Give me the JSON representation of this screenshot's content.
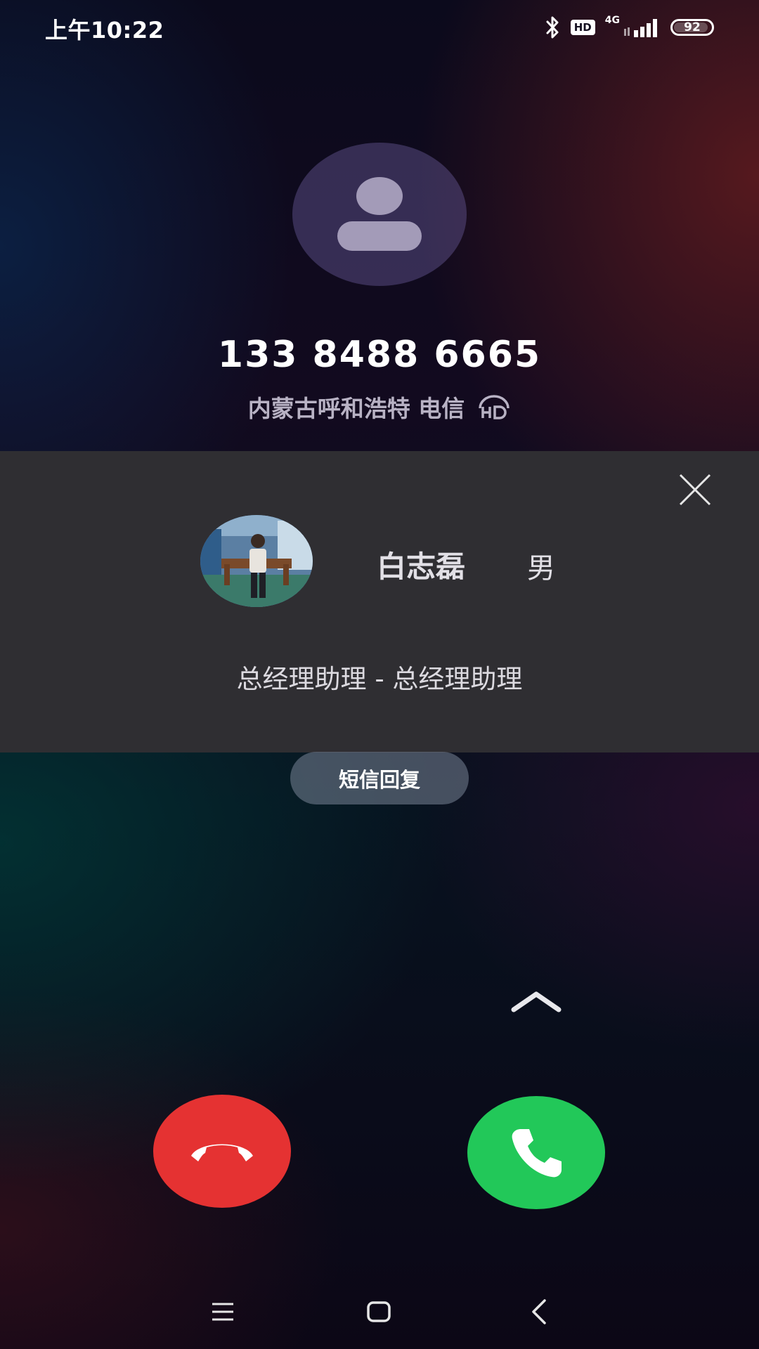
{
  "status_bar": {
    "time": "上午10:22",
    "hd_label": "HD",
    "network_label": "4G",
    "battery_level": "92"
  },
  "caller": {
    "number": "133 8488 6665",
    "location": "内蒙古呼和浩特 电信"
  },
  "contact_card": {
    "name": "白志磊",
    "gender": "男",
    "title": "总经理助理 - 总经理助理"
  },
  "actions": {
    "sms_reply_label": "短信回复"
  },
  "colors": {
    "decline": "#e53232",
    "answer": "#22c859",
    "card_background": "#2f2e32"
  },
  "icons": {
    "bluetooth": "bluetooth-icon",
    "signal": "signal-bars-icon",
    "hd_voice": "hd-voice-icon",
    "close": "close-icon",
    "swipe_up": "chevron-up-icon",
    "decline": "phone-hangup-icon",
    "answer": "phone-icon",
    "nav_menu": "menu-icon",
    "nav_home": "home-icon",
    "nav_back": "back-icon"
  }
}
